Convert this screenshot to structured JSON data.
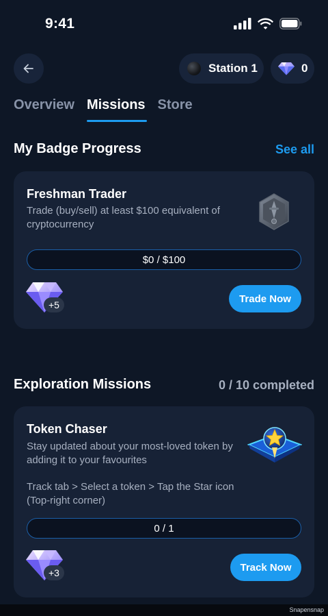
{
  "status_bar": {
    "time": "9:41"
  },
  "header": {
    "station_label": "Station 1",
    "gems_count": "0"
  },
  "tabs": [
    {
      "label": "Overview",
      "active": false
    },
    {
      "label": "Missions",
      "active": true
    },
    {
      "label": "Store",
      "active": false
    }
  ],
  "badge_progress": {
    "title": "My Badge Progress",
    "see_all": "See all",
    "card": {
      "title": "Freshman Trader",
      "description": "Trade (buy/sell) at least $100 equivalent of cryptocurrency",
      "progress_text": "$0 / $100",
      "progress_fraction": 0,
      "reward": "+5",
      "cta": "Trade Now",
      "badge_icon": "locked-badge-icon"
    }
  },
  "exploration": {
    "title": "Exploration Missions",
    "completed": "0 / 10 completed",
    "card": {
      "title": "Token Chaser",
      "description": "Stay updated about your most-loved token by adding it to your favourites",
      "instructions": "Track tab > Select a token > Tap the Star icon (Top-right corner)",
      "progress_text": "0 / 1",
      "progress_fraction": 0,
      "reward": "+3",
      "cta": "Track Now",
      "badge_icon": "star-badge-icon"
    }
  },
  "watermark": "Snapensnap",
  "colors": {
    "background": "#0e1726",
    "card": "#172236",
    "accent": "#1d9bf0",
    "muted_text": "#a7b0c0"
  }
}
